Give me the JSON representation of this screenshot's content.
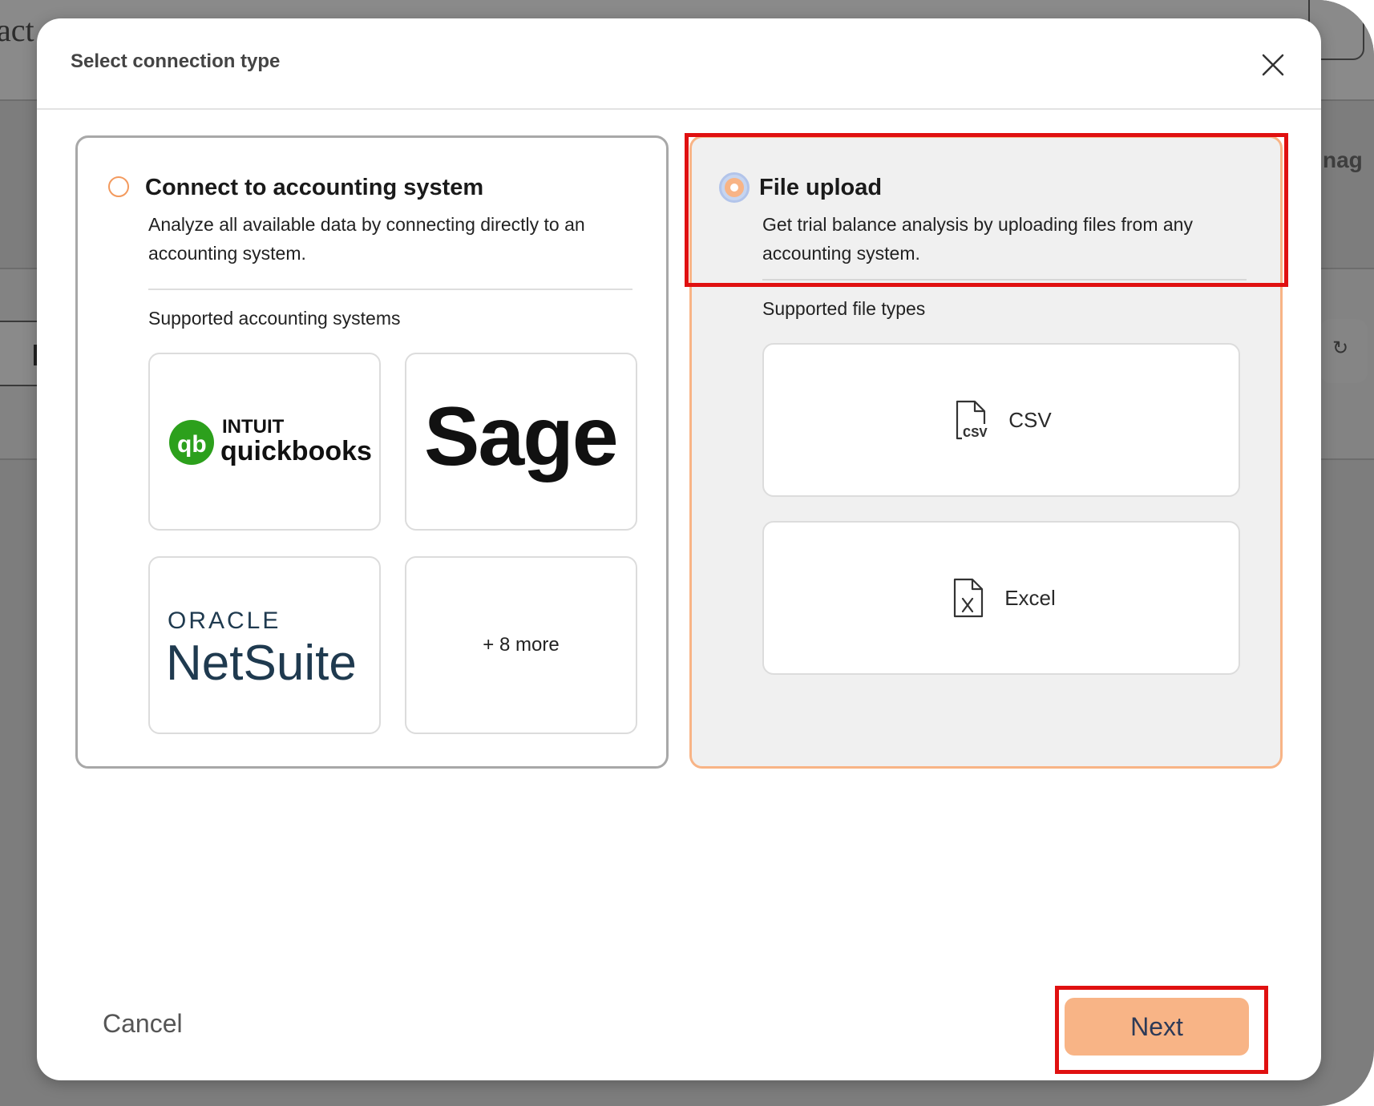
{
  "background": {
    "left_text": "act",
    "right_text": "nag"
  },
  "modal": {
    "title": "Select connection type",
    "close_icon": "close-icon"
  },
  "options": {
    "accounting": {
      "title": "Connect to accounting system",
      "description": "Analyze all available data by connecting directly to an accounting system.",
      "section_label": "Supported accounting systems",
      "selected": false,
      "systems": {
        "quickbooks": {
          "brand_top": "INTUIT",
          "brand_name": "quickbooks",
          "color": "#2ca01c"
        },
        "sage": {
          "brand_name": "Sage"
        },
        "netsuite": {
          "brand_top": "ORACLE",
          "brand_name": "NetSuite",
          "color": "#1f3a4f"
        },
        "more": "+ 8 more"
      }
    },
    "upload": {
      "title": "File upload",
      "description": "Get trial balance analysis by uploading files from any accounting system.",
      "section_label": "Supported file types",
      "selected": true,
      "files": {
        "csv": {
          "label": "CSV",
          "icon": "csv-file-icon"
        },
        "excel": {
          "label": "Excel",
          "icon": "excel-file-icon"
        }
      }
    }
  },
  "footer": {
    "cancel_label": "Cancel",
    "next_label": "Next"
  },
  "colors": {
    "accent": "#f8b486",
    "annotation": "#e01010"
  }
}
